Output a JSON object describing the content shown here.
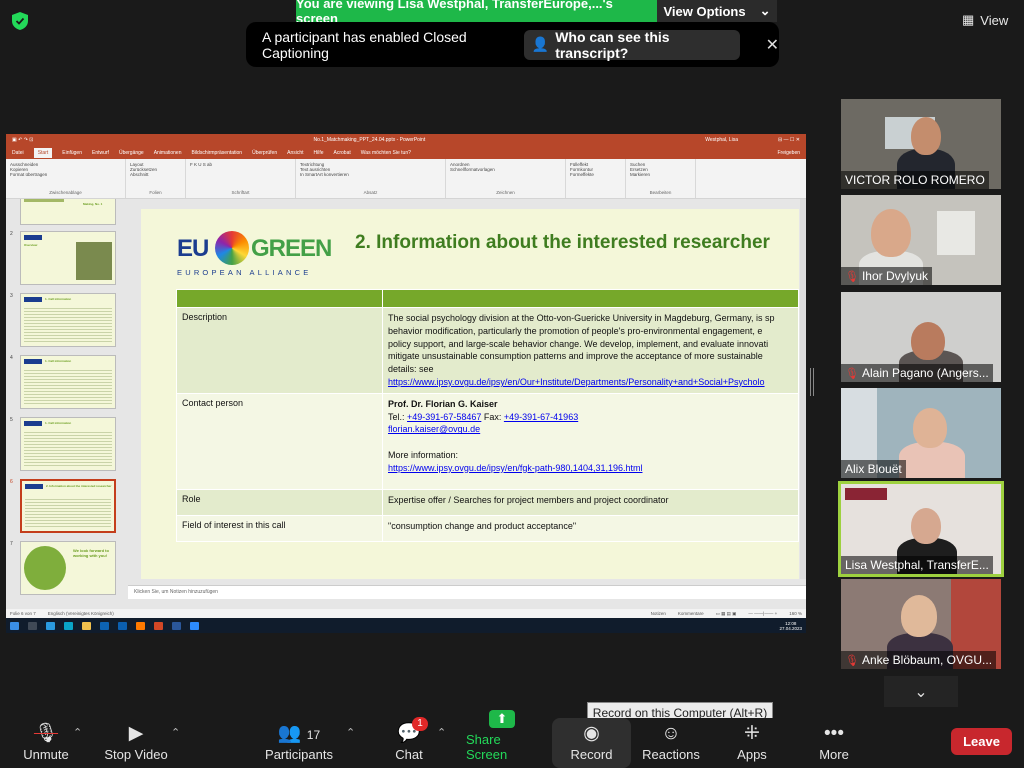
{
  "banner": {
    "viewing_text": "You are viewing Lisa Westphal, TransferEurope,...'s screen",
    "view_options": "View Options",
    "view_label": "View"
  },
  "cc_notice": {
    "message": "A participant has enabled Closed Captioning",
    "who_button": "Who can see this transcript?"
  },
  "ppt": {
    "window_title": "No.1_Matchmaking_PPT_24.04.pptx - PowerPoint",
    "user": "Westphal, Lisa",
    "tabs": [
      "Datei",
      "Start",
      "Einfügen",
      "Entwurf",
      "Übergänge",
      "Animationen",
      "Bildschirmpräsentation",
      "Überprüfen",
      "Ansicht",
      "Hilfe",
      "Acrobat",
      "Was möchten Sie tun?"
    ],
    "share_label": "Freigeben",
    "ribbon_groups": [
      {
        "label": "Zwischenablage",
        "items": [
          "Ausschneiden",
          "Kopieren",
          "Format übertragen"
        ]
      },
      {
        "label": "Folien",
        "items": [
          "Layout",
          "Zurücksetzen",
          "Abschnitt"
        ]
      },
      {
        "label": "Schriftart",
        "items": [
          "F K U S ab"
        ]
      },
      {
        "label": "Absatz",
        "items": [
          "Textrichtung",
          "Text ausrichten",
          "In SmartArt konvertieren"
        ]
      },
      {
        "label": "Zeichnen",
        "items": [
          "Anordnen",
          "Schnellformatvorlagen"
        ]
      },
      {
        "label": "",
        "items": [
          "Fülleffekt",
          "Formkontur",
          "Formeffekte"
        ]
      },
      {
        "label": "Bearbeiten",
        "items": [
          "Suchen",
          "Ersetzen",
          "Markieren"
        ]
      }
    ],
    "thumbs": [
      {
        "num": "",
        "title": "Making, No. 1"
      },
      {
        "num": "2",
        "title": "Overview"
      },
      {
        "num": "3",
        "title": "1. Call information"
      },
      {
        "num": "4",
        "title": "1. Call information"
      },
      {
        "num": "5",
        "title": "1. Call information"
      },
      {
        "num": "6",
        "title": "2. Information about the interested researcher"
      },
      {
        "num": "7",
        "title": "We look forward to working with you!"
      }
    ],
    "notes_placeholder": "Klicken Sie, um Notizen hinzuzufügen",
    "status_slide": "Folie 6 von 7",
    "status_lang": "Englisch (Vereinigtes Königreich)",
    "status_notes": "Notizen",
    "status_comments": "Kommentare",
    "zoom": "160 %",
    "clock_time": "12:08",
    "clock_date": "27.04.2023",
    "clock_lang": "DEU"
  },
  "slide": {
    "logo_eu": "EU",
    "logo_green": "GREEN",
    "logo_alliance": "EUROPEAN ALLIANCE",
    "title": "2. Information about the interested researcher",
    "rows": {
      "description_label": "Description",
      "description_lines": [
        "The social psychology division at the Otto-von-Guericke University in Magdeburg, Germany, is sp",
        "behavior modification, particularly the promotion of people's pro-environmental engagement, e",
        "policy support, and large-scale behavior change. We develop, implement, and evaluate innovati",
        "mitigate unsustainable consumption patterns and improve the acceptance of more sustainable",
        "details: see"
      ],
      "description_link": "https://www.ipsy.ovgu.de/ipsy/en/Our+Institute/Departments/Personality+and+Social+Psycholo",
      "contact_label": "Contact person",
      "contact_name": "Prof. Dr. Florian G. Kaiser",
      "contact_tel_label": "Tel.:",
      "contact_tel": "+49-391-67-58467",
      "contact_fax_label": "Fax:",
      "contact_fax": "+49-391-67-41963",
      "contact_email": "florian.kaiser@ovgu.de",
      "more_info_label": "More information:",
      "more_info_link": "https://www.ipsy.ovgu.de/ipsy/en/fgk-path-980,1404,31,196.html",
      "role_label": "Role",
      "role_value": "Expertise offer / Searches for project members and project coordinator",
      "field_label": "Field of interest in this call",
      "field_value": "\"consumption change and product acceptance\""
    }
  },
  "participants": [
    {
      "name": "VICTOR ROLO ROMERO",
      "muted": false
    },
    {
      "name": "Ihor Dvylyuk",
      "muted": true
    },
    {
      "name": "Alain Pagano (Angers...",
      "muted": true
    },
    {
      "name": "Alix Blouët",
      "muted": false
    },
    {
      "name": "Lisa Westphal, TransferE...",
      "muted": false
    },
    {
      "name": "Anke Blöbaum, OVGU...",
      "muted": true
    }
  ],
  "toolbar": {
    "unmute": "Unmute",
    "stop_video": "Stop Video",
    "participants": "Participants",
    "participants_count": "17",
    "chat": "Chat",
    "chat_badge": "1",
    "share_screen": "Share Screen",
    "record": "Record",
    "reactions": "Reactions",
    "apps": "Apps",
    "more": "More",
    "leave": "Leave",
    "record_tooltip": "Record on this Computer (Alt+R)"
  },
  "colors": {
    "banner_green": "#1eb849",
    "ppt_red": "#b7472a",
    "slide_green": "#3f7d20",
    "table_header": "#76a82a",
    "leave_red": "#c8272d",
    "active_speaker": "#9ed13f"
  }
}
